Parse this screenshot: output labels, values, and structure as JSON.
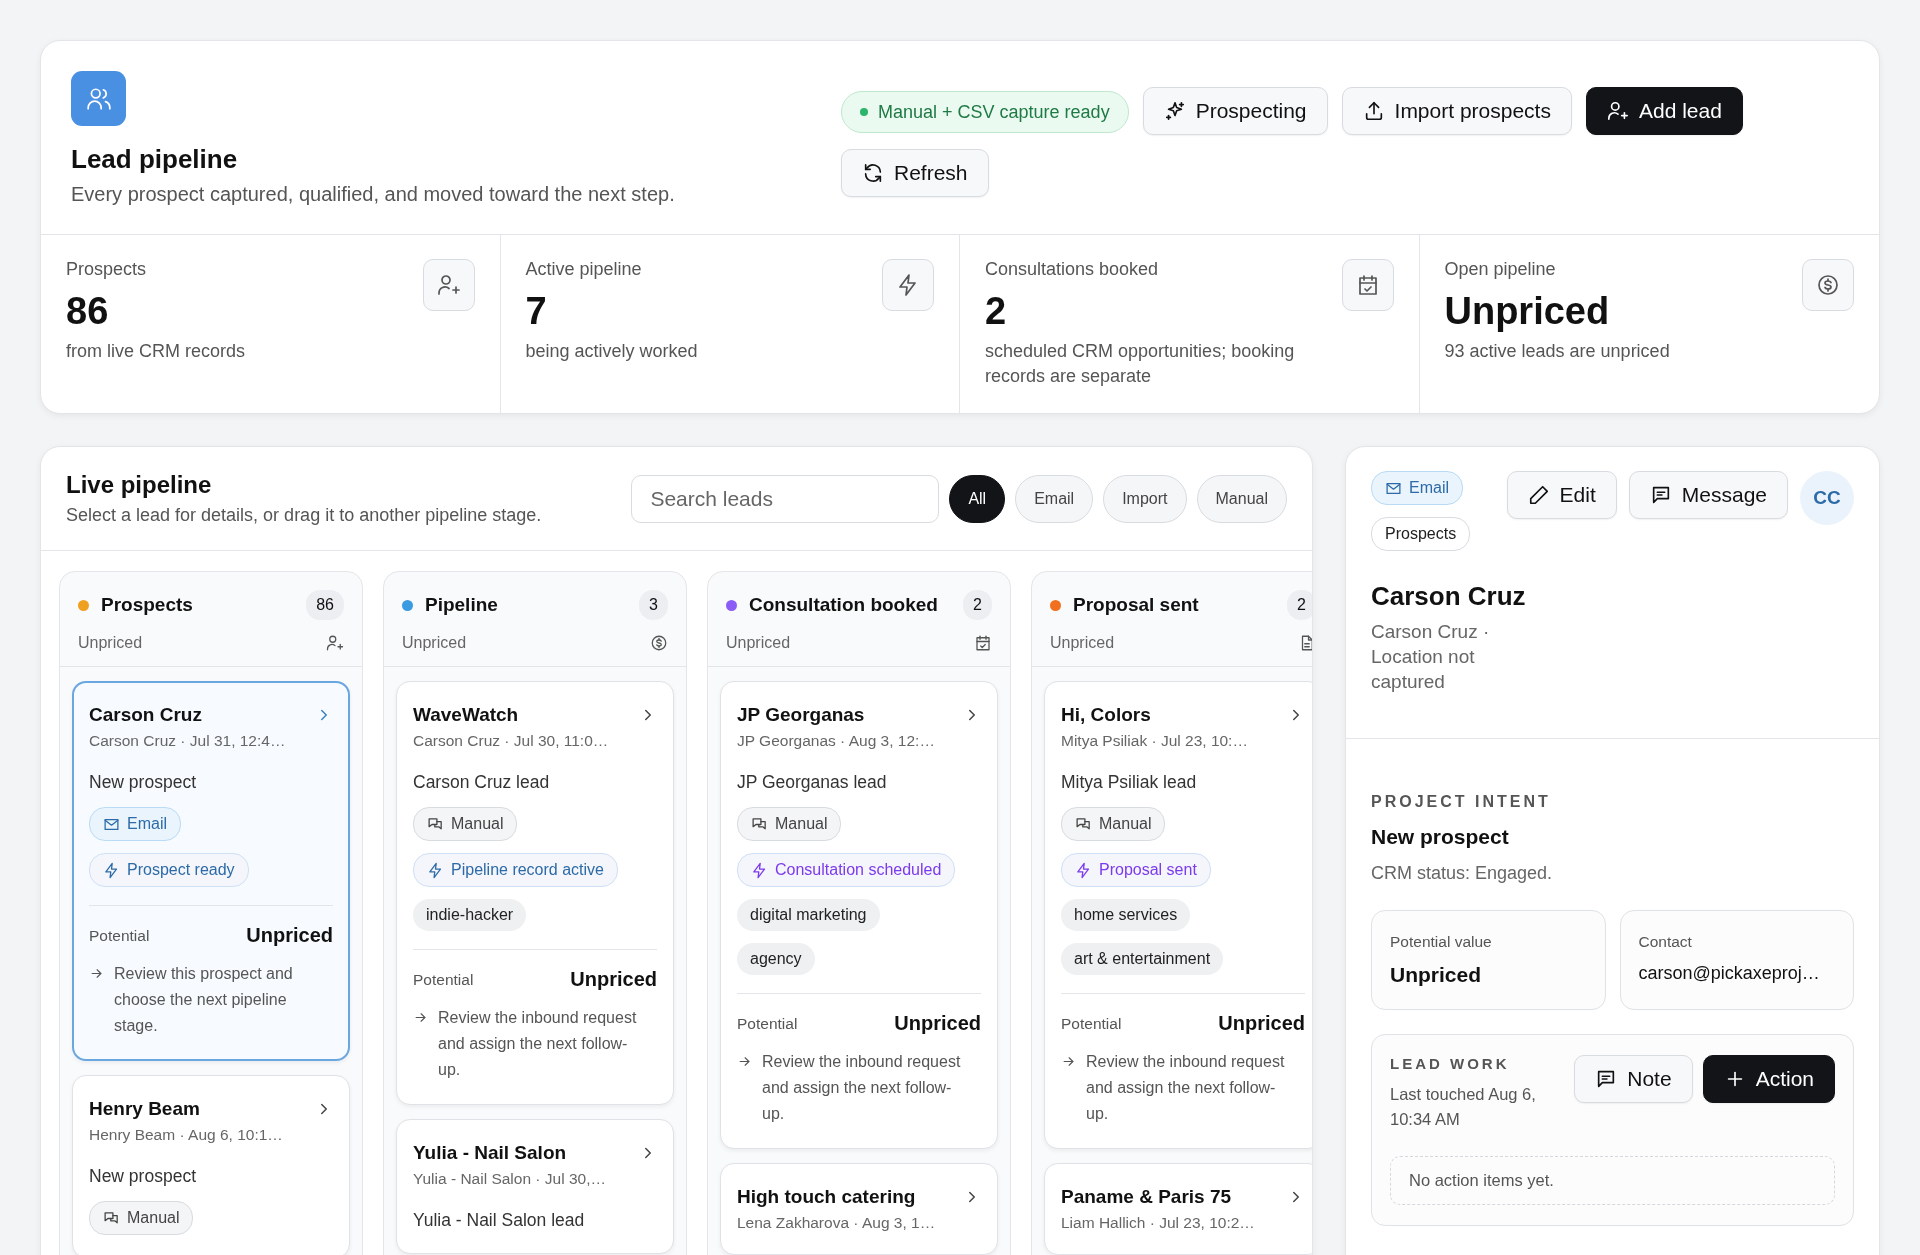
{
  "header": {
    "title": "Lead pipeline",
    "subtitle": "Every prospect captured, qualified, and moved toward the next step.",
    "status_badge": "Manual + CSV capture ready",
    "actions": [
      {
        "label": "Prospecting",
        "primary": false
      },
      {
        "label": "Import prospects",
        "primary": false
      },
      {
        "label": "Add lead",
        "primary": true
      },
      {
        "label": "Refresh",
        "primary": false
      }
    ]
  },
  "stats": [
    {
      "label": "Prospects",
      "value": "86",
      "note": "from live CRM records"
    },
    {
      "label": "Active pipeline",
      "value": "7",
      "note": "being actively worked"
    },
    {
      "label": "Consultations booked",
      "value": "2",
      "note": "scheduled CRM opportunities; booking records are separate"
    },
    {
      "label": "Open pipeline",
      "value": "Unpriced",
      "note": "93 active leads are unpriced"
    }
  ],
  "live_pipeline": {
    "title": "Live pipeline",
    "subtitle": "Select a lead for details, or drag it to another pipeline stage.",
    "search": {
      "placeholder": "Search leads"
    },
    "filters": [
      {
        "label": "All",
        "selected": true
      },
      {
        "label": "Email",
        "selected": false
      },
      {
        "label": "Import",
        "selected": false
      },
      {
        "label": "Manual",
        "selected": false
      }
    ],
    "columns": [
      {
        "name": "Prospects",
        "color": "#f0a020",
        "count": "86",
        "subtitle": "Unpriced",
        "cards": [
          {
            "title": "Carson Cruz",
            "meta": "Carson Cruz · Jul 31, 12:4…",
            "summary": "New prospect",
            "selected": true,
            "tags": [
              {
                "label": "Email",
                "kind": "email"
              },
              {
                "label": "Prospect ready",
                "kind": "status",
                "color": "#2c6aa8"
              }
            ],
            "potential_label": "Potential",
            "potential_value": "Unpriced",
            "next_step": "Review this prospect and choose the next pipeline stage."
          },
          {
            "title": "Henry Beam",
            "meta": "Henry Beam · Aug 6, 10:1…",
            "summary": "New prospect",
            "selected": false,
            "tags": [
              {
                "label": "Manual",
                "kind": "manual"
              }
            ]
          }
        ]
      },
      {
        "name": "Pipeline",
        "color": "#3b9be0",
        "count": "3",
        "subtitle": "Unpriced",
        "cards": [
          {
            "title": "WaveWatch",
            "meta": "Carson Cruz · Jul 30, 11:0…",
            "summary": "Carson Cruz lead",
            "selected": false,
            "tags": [
              {
                "label": "Manual",
                "kind": "manual"
              },
              {
                "label": "Pipeline record active",
                "kind": "status",
                "color": "#2c6aa8"
              },
              {
                "label": "indie-hacker",
                "kind": "topic"
              }
            ],
            "potential_label": "Potential",
            "potential_value": "Unpriced",
            "next_step": "Review the inbound request and assign the next follow-up."
          },
          {
            "title": "Yulia - Nail Salon",
            "meta": "Yulia - Nail Salon · Jul 30,…",
            "summary": "Yulia - Nail Salon lead",
            "selected": false
          }
        ]
      },
      {
        "name": "Consultation booked",
        "color": "#8b5cf6",
        "count": "2",
        "subtitle": "Unpriced",
        "cards": [
          {
            "title": "JP Georganas",
            "meta": "JP Georganas · Aug 3, 12:…",
            "summary": "JP Georganas lead",
            "selected": false,
            "tags": [
              {
                "label": "Manual",
                "kind": "manual"
              },
              {
                "label": "Consultation scheduled",
                "kind": "status",
                "color": "#7c3aed"
              },
              {
                "label": "digital marketing",
                "kind": "topic"
              },
              {
                "label": "agency",
                "kind": "topic"
              }
            ],
            "potential_label": "Potential",
            "potential_value": "Unpriced",
            "next_step": "Review the inbound request and assign the next follow-up."
          },
          {
            "title": "High touch catering",
            "meta": "Lena Zakharova · Aug 3, 1…",
            "selected": false
          }
        ]
      },
      {
        "name": "Proposal sent",
        "color": "#f07020",
        "count": "2",
        "subtitle": "Unpriced",
        "cards": [
          {
            "title": "Hi, Colors",
            "meta": "Mitya Psiliak · Jul 23, 10:…",
            "summary": "Mitya Psiliak lead",
            "selected": false,
            "tags": [
              {
                "label": "Manual",
                "kind": "manual"
              },
              {
                "label": "Proposal sent",
                "kind": "status",
                "color": "#7c3aed"
              },
              {
                "label": "home services",
                "kind": "topic"
              },
              {
                "label": "art & entertainment",
                "kind": "topic"
              }
            ],
            "potential_label": "Potential",
            "potential_value": "Unpriced",
            "next_step": "Review the inbound request and assign the next follow-up."
          },
          {
            "title": "Paname & Paris 75",
            "meta": "Liam Hallich · Jul 23, 10:2…",
            "selected": false
          }
        ]
      }
    ]
  },
  "detail": {
    "tags": [
      {
        "label": "Email",
        "kind": "email"
      },
      {
        "label": "Prospects",
        "kind": "stage"
      }
    ],
    "buttons": [
      "Edit",
      "Message"
    ],
    "avatar": "CC",
    "name": "Carson Cruz",
    "location": "Carson Cruz · Location not captured",
    "section_label": "PROJECT INTENT",
    "intent": "New prospect",
    "crm_status": "CRM status: Engaged.",
    "fields": [
      {
        "label": "Potential value",
        "value": "Unpriced"
      },
      {
        "label": "Contact",
        "value": "carson@pickaxeproj…"
      }
    ],
    "lead_work": {
      "label": "LEAD WORK",
      "last_touched": "Last touched Aug 6, 10:34 AM",
      "buttons": [
        {
          "label": "Note",
          "primary": false
        },
        {
          "label": "Action",
          "primary": true
        }
      ],
      "empty": "No action items yet."
    }
  }
}
